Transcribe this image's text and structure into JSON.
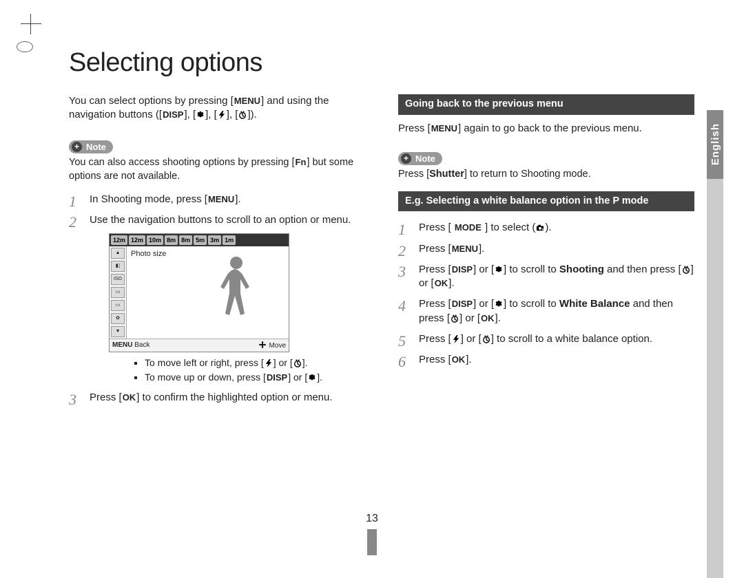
{
  "lang_tab": "English",
  "title": "Selecting options",
  "left": {
    "intro_a": "You can select options by pressing [",
    "intro_menu": "MENU",
    "intro_b": "] and using the navigation buttons ([",
    "intro_disp": "DISP",
    "intro_sep": "], [",
    "intro_end": "]).",
    "note_label": "Note",
    "note_text_a": "You can also access shooting options by pressing [",
    "note_fn": "Fn",
    "note_text_b": "] but some options are not available.",
    "step1_a": "In Shooting mode, press [",
    "step1_menu": "MENU",
    "step1_b": "].",
    "step2": "Use the navigation buttons to scroll to an option or menu.",
    "screen": {
      "sizes": [
        "12m",
        "12m",
        "10m",
        "8m",
        "8m",
        "5m",
        "3m",
        "1m"
      ],
      "label": "Photo size",
      "back": "Back",
      "back_key": "MENU",
      "move": "Move"
    },
    "bullet1_a": "To move left or right, press [",
    "bullet1_b": "] or [",
    "bullet1_c": "].",
    "bullet2_a": "To move up or down, press [",
    "bullet2_disp": "DISP",
    "bullet2_b": "] or [",
    "bullet2_c": "].",
    "step3_a": "Press [",
    "step3_ok": "OK",
    "step3_b": "] to confirm the highlighted option or menu."
  },
  "right": {
    "h1": "Going back to the previous menu",
    "back_a": "Press [",
    "back_menu": "MENU",
    "back_b": "] again to go back to the previous menu.",
    "note_label": "Note",
    "note2_a": "Press [",
    "note2_shutter": "Shutter",
    "note2_b": "] to return to Shooting mode.",
    "h2": "E.g. Selecting a white balance option in the P mode",
    "s1_a": "Press [ ",
    "s1_mode": "MODE",
    "s1_b": " ] to select (",
    "s1_c": ").",
    "s2_a": "Press [",
    "s2_menu": "MENU",
    "s2_b": "].",
    "s3_a": "Press [",
    "s3_disp": "DISP",
    "s3_b": "] or [",
    "s3_c": "] to scroll to ",
    "s3_bold": "Shooting",
    "s3_d": " and then press [",
    "s3_e": "] or [",
    "s3_ok": "OK",
    "s3_f": "].",
    "s4_a": "Press [",
    "s4_disp": "DISP",
    "s4_b": "] or [",
    "s4_c": "] to scroll to ",
    "s4_bold": "White Balance",
    "s4_d": " and then press [",
    "s4_e": "] or [",
    "s4_ok": "OK",
    "s4_f": "].",
    "s5_a": "Press [",
    "s5_b": "] or [",
    "s5_c": "] to scroll to a white balance option.",
    "s6_a": "Press [",
    "s6_ok": "OK",
    "s6_b": "]."
  },
  "page_number": "13"
}
